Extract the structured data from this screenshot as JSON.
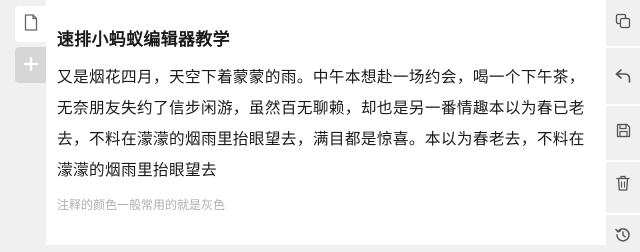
{
  "editor": {
    "title": "速排小蚂蚁编辑器教学",
    "paragraph": "又是烟花四月，天空下着蒙蒙的雨。中午本想赴一场约会，喝一个下午茶，无奈朋友失约了信步闲游，虽然百无聊赖，却也是另一番情趣本以为春已老去，不料在濛濛的烟雨里抬眼望去，满目都是惊喜。本以为春老去，不料在濛濛的烟雨里抬眼望去",
    "note": "注释的颜色一般常用的就是灰色"
  },
  "left_rail": {
    "items": [
      {
        "name": "document",
        "icon": "document-icon"
      },
      {
        "name": "add",
        "icon": "plus-icon"
      }
    ]
  },
  "right_toolbar": {
    "items": [
      {
        "icon": "copy-icon"
      },
      {
        "icon": "undo-icon"
      },
      {
        "icon": "save-icon"
      },
      {
        "icon": "trash-icon"
      },
      {
        "icon": "history-icon"
      }
    ]
  },
  "colors": {
    "background": "#f0f0f0",
    "editor": "#ffffff",
    "text": "#1a1a1a",
    "note": "#b0b0b0",
    "icon": "#555555"
  }
}
